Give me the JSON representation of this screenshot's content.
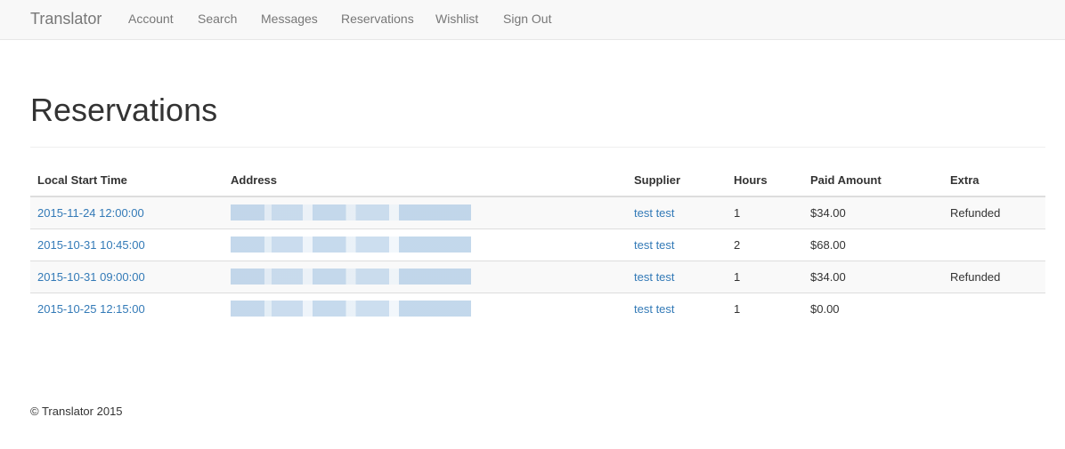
{
  "navbar": {
    "brand": "Translator",
    "links": [
      "Account",
      "Search",
      "Messages",
      "Reservations",
      "Wishlist",
      "Sign Out"
    ]
  },
  "page": {
    "title": "Reservations"
  },
  "table": {
    "headers": [
      "Local Start Time",
      "Address",
      "Supplier",
      "Hours",
      "Paid Amount",
      "Extra"
    ],
    "rows": [
      {
        "start": "2015-11-24 12:00:00",
        "supplier": "test test",
        "hours": "1",
        "paid": "$34.00",
        "extra": "Refunded"
      },
      {
        "start": "2015-10-31 10:45:00",
        "supplier": "test test",
        "hours": "2",
        "paid": "$68.00",
        "extra": ""
      },
      {
        "start": "2015-10-31 09:00:00",
        "supplier": "test test",
        "hours": "1",
        "paid": "$34.00",
        "extra": "Refunded"
      },
      {
        "start": "2015-10-25 12:15:00",
        "supplier": "test test",
        "hours": "1",
        "paid": "$0.00",
        "extra": ""
      }
    ]
  },
  "footer": {
    "text": "© Translator 2015"
  },
  "colors": {
    "link": "#337ab7",
    "navbar_bg": "#f8f8f8",
    "nav_text": "#777777"
  }
}
